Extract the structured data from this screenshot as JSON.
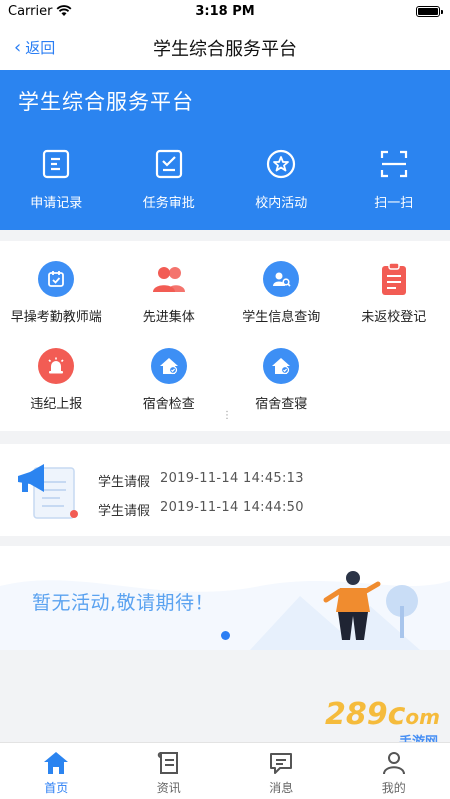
{
  "status_bar": {
    "carrier": "Carrier",
    "time": "3:18 PM"
  },
  "nav": {
    "back_label": "返回",
    "title": "学生综合服务平台"
  },
  "header": {
    "title": "学生综合服务平台"
  },
  "quick_actions": [
    {
      "label": "申请记录",
      "icon": "application-record-icon"
    },
    {
      "label": "任务审批",
      "icon": "task-approval-icon"
    },
    {
      "label": "校内活动",
      "icon": "campus-activity-icon"
    },
    {
      "label": "扫一扫",
      "icon": "scan-icon"
    }
  ],
  "grid": [
    {
      "label": "早操考勤教师端",
      "icon": "calendar-check-icon",
      "color": "#3d8ff5"
    },
    {
      "label": "先进集体",
      "icon": "group-icon",
      "color": "#f25c54"
    },
    {
      "label": "学生信息查询",
      "icon": "user-search-icon",
      "color": "#3d8ff5"
    },
    {
      "label": "未返校登记",
      "icon": "clipboard-icon",
      "color": "#f25c54"
    },
    {
      "label": "违纪上报",
      "icon": "alarm-icon",
      "color": "#f25c54"
    },
    {
      "label": "宿舍检查",
      "icon": "home-check-icon",
      "color": "#3d8ff5"
    },
    {
      "label": "宿舍查寝",
      "icon": "home-verify-icon",
      "color": "#3d8ff5"
    }
  ],
  "notices": [
    {
      "type": "学生请假",
      "time": "2019-11-14 14:45:13"
    },
    {
      "type": "学生请假",
      "time": "2019-11-14 14:44:50"
    }
  ],
  "banner": {
    "message": "暂无活动,敬请期待！"
  },
  "tabs": [
    {
      "label": "首页",
      "icon": "home-icon",
      "active": true
    },
    {
      "label": "资讯",
      "icon": "news-icon",
      "active": false
    },
    {
      "label": "消息",
      "icon": "message-icon",
      "active": false
    },
    {
      "label": "我的",
      "icon": "profile-icon",
      "active": false
    }
  ],
  "watermark": {
    "main": "289",
    "sub": "手游网"
  },
  "colors": {
    "primary": "#2b84f0",
    "red": "#f25c54",
    "background": "#f2f3f5"
  }
}
